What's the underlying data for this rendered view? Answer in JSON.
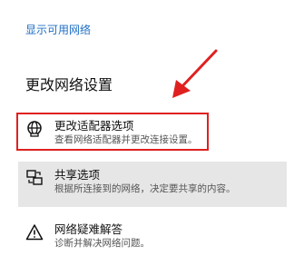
{
  "links": {
    "show_available_networks": "显示可用网络"
  },
  "section": {
    "title": "更改网络设置"
  },
  "options": [
    {
      "title": "更改适配器选项",
      "description": "查看网络适配器并更改连接设置。",
      "icon": "adapter-icon"
    },
    {
      "title": "共享选项",
      "description": "根据所连接到的网络，决定要共享的内容。",
      "icon": "sharing-icon"
    },
    {
      "title": "网络疑难解答",
      "description": "诊断并解决网络问题。",
      "icon": "warning-icon"
    }
  ],
  "colors": {
    "link": "#1f6fc4",
    "highlight_border": "#e02020",
    "annotation_arrow": "#e02020",
    "hover_bg": "#e6e6e6"
  }
}
